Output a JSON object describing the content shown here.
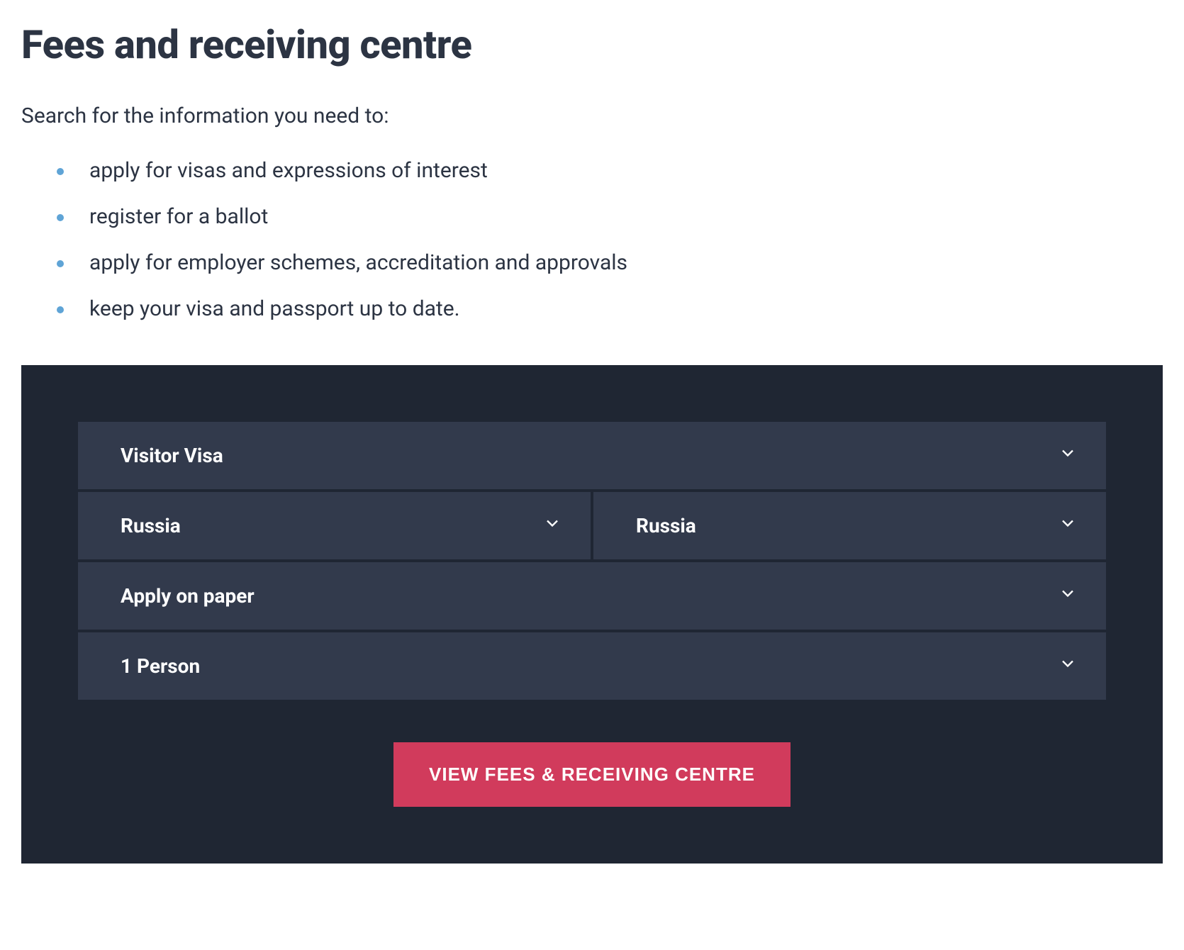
{
  "heading": "Fees and receiving centre",
  "intro": "Search for the information you need to:",
  "bullets": [
    "apply for visas and expressions of interest",
    "register for a ballot",
    "apply for employer schemes, accreditation and approvals",
    "keep your visa and passport up to date."
  ],
  "form": {
    "visa_type": "Visitor Visa",
    "country_a": "Russia",
    "country_b": "Russia",
    "method": "Apply on paper",
    "persons": "1 Person"
  },
  "cta_label": "VIEW FEES & RECEIVING CENTRE"
}
